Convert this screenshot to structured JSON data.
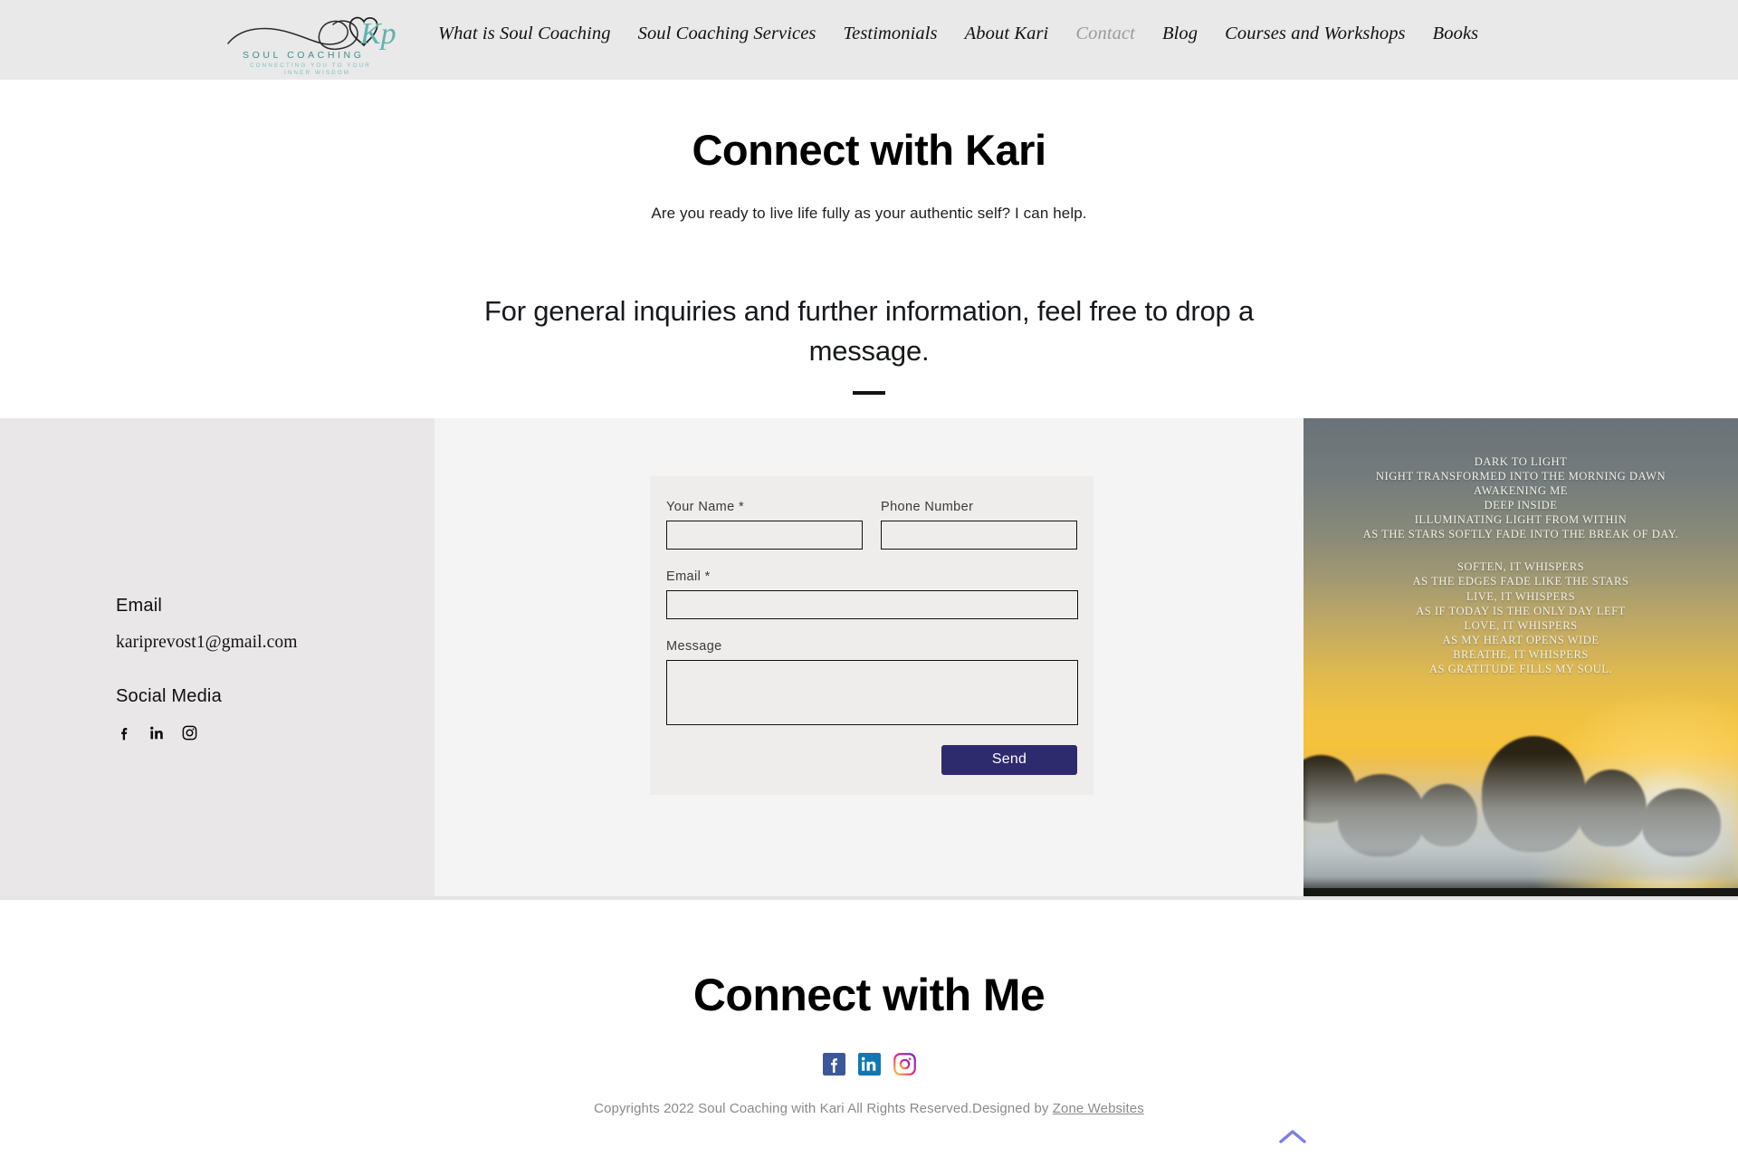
{
  "header": {
    "logo": {
      "name": "soul-coaching-logo",
      "brand": "SOUL COACHING",
      "tagline_line1": "CONNECTING YOU TO YOUR",
      "tagline_line2": "INNER WISDOM",
      "monogram": "Kp",
      "brand_color": "#5fb3ad",
      "background": "#e9e9e9"
    },
    "nav": [
      {
        "label": "What is Soul Coaching",
        "active": false
      },
      {
        "label": "Soul Coaching Services",
        "active": false
      },
      {
        "label": "Testimonials",
        "active": false
      },
      {
        "label": "About Kari",
        "active": false
      },
      {
        "label": "Contact",
        "active": true
      },
      {
        "label": "Blog",
        "active": false
      },
      {
        "label": "Courses and Workshops",
        "active": false
      },
      {
        "label": "Books",
        "active": false
      }
    ]
  },
  "hero": {
    "title": "Connect with Kari",
    "subtitle": "Are you ready to live life fully as your authentic self?  I can help.",
    "lead": "For general inquiries and further information, feel free to drop a message."
  },
  "contact_info": {
    "email_heading": "Email",
    "email_value": "kariprevost1@gmail.com",
    "social_heading": "Social Media",
    "social_icons": [
      "facebook-icon",
      "linkedin-icon",
      "instagram-icon"
    ]
  },
  "form": {
    "fields": {
      "name_label": "Your Name *",
      "name_value": "",
      "name_placeholder": "",
      "phone_label": "Phone Number",
      "phone_value": "",
      "phone_placeholder": "",
      "email_label": "Email *",
      "email_value": "",
      "email_placeholder": "",
      "message_label": "Message",
      "message_value": "",
      "message_placeholder": ""
    },
    "send_label": "Send",
    "send_color": "#2d2a6e"
  },
  "photo": {
    "name": "sunrise-poem-image",
    "poem_stanza_1": [
      "DARK TO LIGHT",
      "NIGHT TRANSFORMED INTO THE MORNING DAWN",
      "AWAKENING ME",
      "DEEP INSIDE",
      "ILLUMINATING LIGHT FROM WITHIN",
      "AS THE STARS SOFTLY FADE INTO THE BREAK OF DAY."
    ],
    "poem_stanza_2": [
      "SOFTEN, IT WHISPERS",
      "AS THE EDGES FADE LIKE THE STARS",
      "LIVE, IT WHISPERS",
      "AS IF TODAY IS THE ONLY DAY LEFT",
      "LOVE, IT WHISPERS",
      "AS MY HEART OPENS WIDE",
      "BREATHE, IT WHISPERS",
      "AS GRATITUDE FILLS MY SOUL."
    ]
  },
  "footer": {
    "title": "Connect with Me",
    "social_icons": [
      "facebook-icon",
      "linkedin-icon",
      "instagram-icon"
    ],
    "copyright_text": "Copyrights 2022 Soul Coaching with Kari  All Rights Reserved.Designed by ",
    "designer_link": "Zone Websites",
    "scroll_top_icon": "chevron-up-icon",
    "scroll_top_color": "#7b7fe0"
  }
}
